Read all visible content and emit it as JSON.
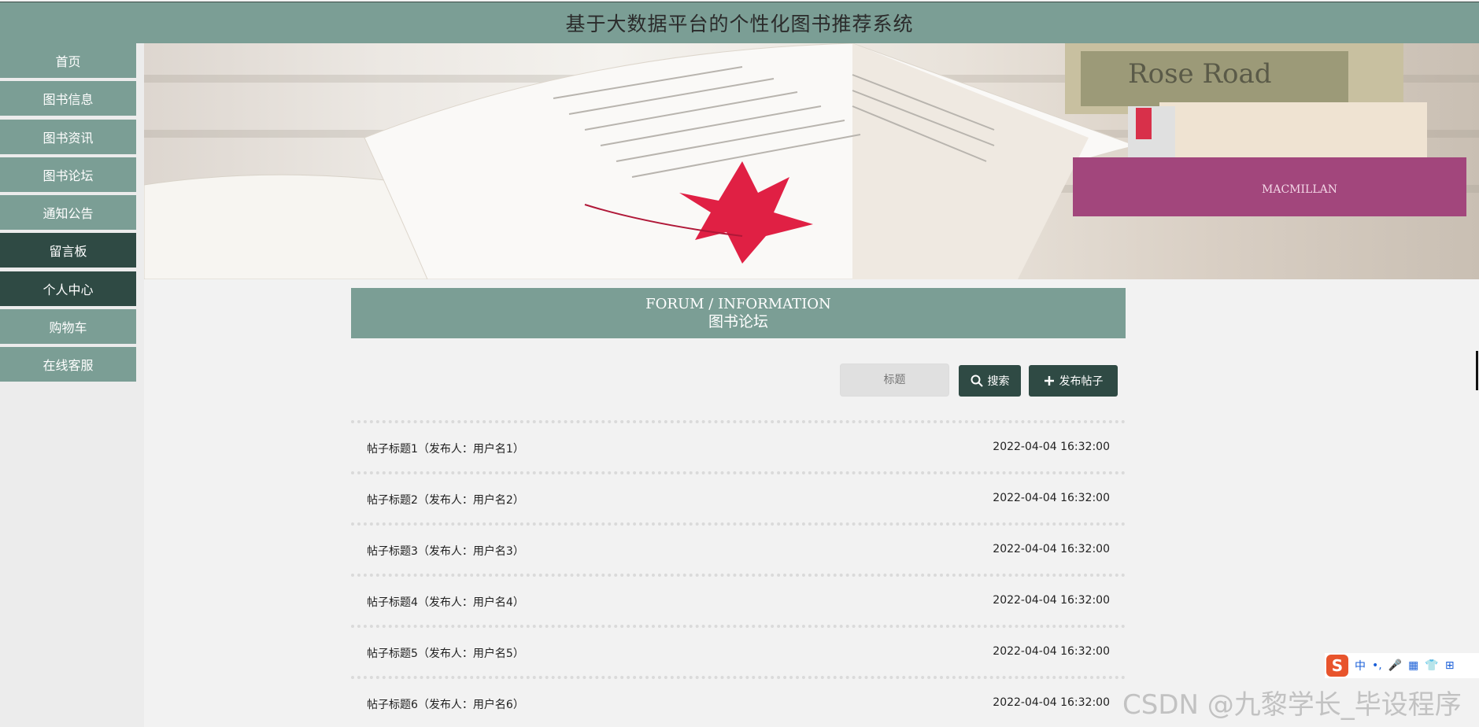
{
  "header": {
    "title": "基于大数据平台的个性化图书推荐系统"
  },
  "sidebar": {
    "items": [
      {
        "label": "首页"
      },
      {
        "label": "图书信息"
      },
      {
        "label": "图书资讯"
      },
      {
        "label": "图书论坛"
      },
      {
        "label": "通知公告"
      },
      {
        "label": "留言板"
      },
      {
        "label": "个人中心"
      },
      {
        "label": "购物车"
      },
      {
        "label": "在线客服"
      }
    ]
  },
  "banner": {
    "book_spine_text": "Rose Road",
    "book_spine_text2": "MACMILLAN"
  },
  "section": {
    "title_en": "FORUM / INFORMATION",
    "title_cn": "图书论坛"
  },
  "toolbar": {
    "search_placeholder": "标题",
    "search_label": "搜索",
    "post_label": "发布帖子"
  },
  "posts": [
    {
      "title": "帖子标题1（发布人：用户名1）",
      "date": "2022-04-04 16:32:00"
    },
    {
      "title": "帖子标题2（发布人：用户名2）",
      "date": "2022-04-04 16:32:00"
    },
    {
      "title": "帖子标题3（发布人：用户名3）",
      "date": "2022-04-04 16:32:00"
    },
    {
      "title": "帖子标题4（发布人：用户名4）",
      "date": "2022-04-04 16:32:00"
    },
    {
      "title": "帖子标题5（发布人：用户名5）",
      "date": "2022-04-04 16:32:00"
    },
    {
      "title": "帖子标题6（发布人：用户名6）",
      "date": "2022-04-04 16:32:00"
    }
  ],
  "ime": {
    "logo": "S",
    "mode": "中"
  },
  "watermark": "CSDN @九黎学长_毕设程序",
  "colors": {
    "accent": "#7b9e95",
    "dark": "#2f4a44",
    "background": "#f2f2f2"
  }
}
